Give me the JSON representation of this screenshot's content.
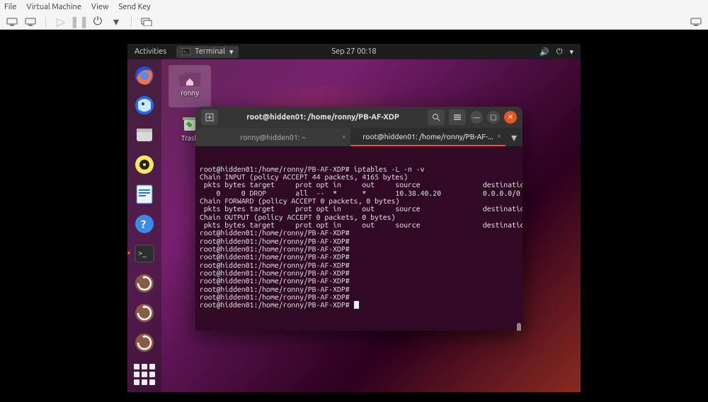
{
  "vm_menu": {
    "file": "File",
    "vm": "Virtual Machine",
    "view": "View",
    "send_key": "Send Key"
  },
  "topbar": {
    "activities": "Activities",
    "app_label": "Terminal",
    "clock": "Sep 27  00:18"
  },
  "desktop": {
    "home_label": "ronny",
    "trash_label": "Trash"
  },
  "terminal": {
    "title": "root@hidden01: /home/ronny/PB-AF-XDP",
    "tab_inactive": "ronny@hidden01: ~",
    "tab_active": "root@hidden01: /home/ronny/PB-AF-...",
    "lines": [
      "root@hidden01:/home/ronny/PB-AF-XDP# iptables -L -n -v",
      "Chain INPUT (policy ACCEPT 44 packets, 4165 bytes)",
      " pkts bytes target     prot opt in     out     source               destination",
      "",
      "    0     0 DROP       all  --  *      *       10.38.40.20          0.0.0.0/0",
      "",
      "",
      "Chain FORWARD (policy ACCEPT 0 packets, 0 bytes)",
      " pkts bytes target     prot opt in     out     source               destination",
      "",
      "",
      "Chain OUTPUT (policy ACCEPT 0 packets, 0 bytes)",
      " pkts bytes target     prot opt in     out     source               destination",
      "",
      "root@hidden01:/home/ronny/PB-AF-XDP#",
      "root@hidden01:/home/ronny/PB-AF-XDP#",
      "root@hidden01:/home/ronny/PB-AF-XDP#",
      "root@hidden01:/home/ronny/PB-AF-XDP#",
      "root@hidden01:/home/ronny/PB-AF-XDP#",
      "root@hidden01:/home/ronny/PB-AF-XDP#",
      "root@hidden01:/home/ronny/PB-AF-XDP#",
      "root@hidden01:/home/ronny/PB-AF-XDP#",
      "root@hidden01:/home/ronny/PB-AF-XDP#",
      "root@hidden01:/home/ronny/PB-AF-XDP# "
    ]
  },
  "dock_items": [
    "firefox",
    "thunderbird",
    "files",
    "rhythmbox",
    "writer",
    "help",
    "terminal",
    "software-updater-1",
    "software-updater-2",
    "software-updater-3"
  ]
}
